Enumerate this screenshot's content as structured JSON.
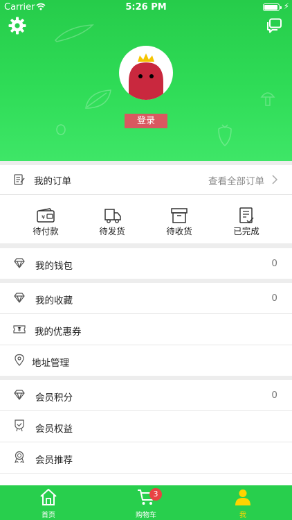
{
  "status_bar": {
    "carrier": "Carrier",
    "time": "5:26 PM"
  },
  "header": {
    "login_label": "登录"
  },
  "orders": {
    "title": "我的订单",
    "view_all": "查看全部订单",
    "items": [
      {
        "label": "待付款",
        "icon": "wallet-icon"
      },
      {
        "label": "待发货",
        "icon": "truck-icon"
      },
      {
        "label": "待收货",
        "icon": "box-icon"
      },
      {
        "label": "已完成",
        "icon": "done-list-icon"
      }
    ]
  },
  "menu": {
    "wallet": {
      "label": "我的钱包",
      "value": "0"
    },
    "favorites": {
      "label": "我的收藏",
      "value": "0"
    },
    "coupons": {
      "label": "我的优惠券"
    },
    "address": {
      "label": "地址管理"
    },
    "points": {
      "label": "会员积分",
      "value": "0"
    },
    "rights": {
      "label": "会员权益"
    },
    "recommend": {
      "label": "会员推荐"
    }
  },
  "tabbar": {
    "home": "首页",
    "cart": "购物车",
    "cart_badge": "3",
    "me": "我"
  },
  "colors": {
    "brand_green": "#28cf4d",
    "login_red": "#d95860",
    "active_tab": "#ffd400",
    "badge_red": "#e84343"
  }
}
